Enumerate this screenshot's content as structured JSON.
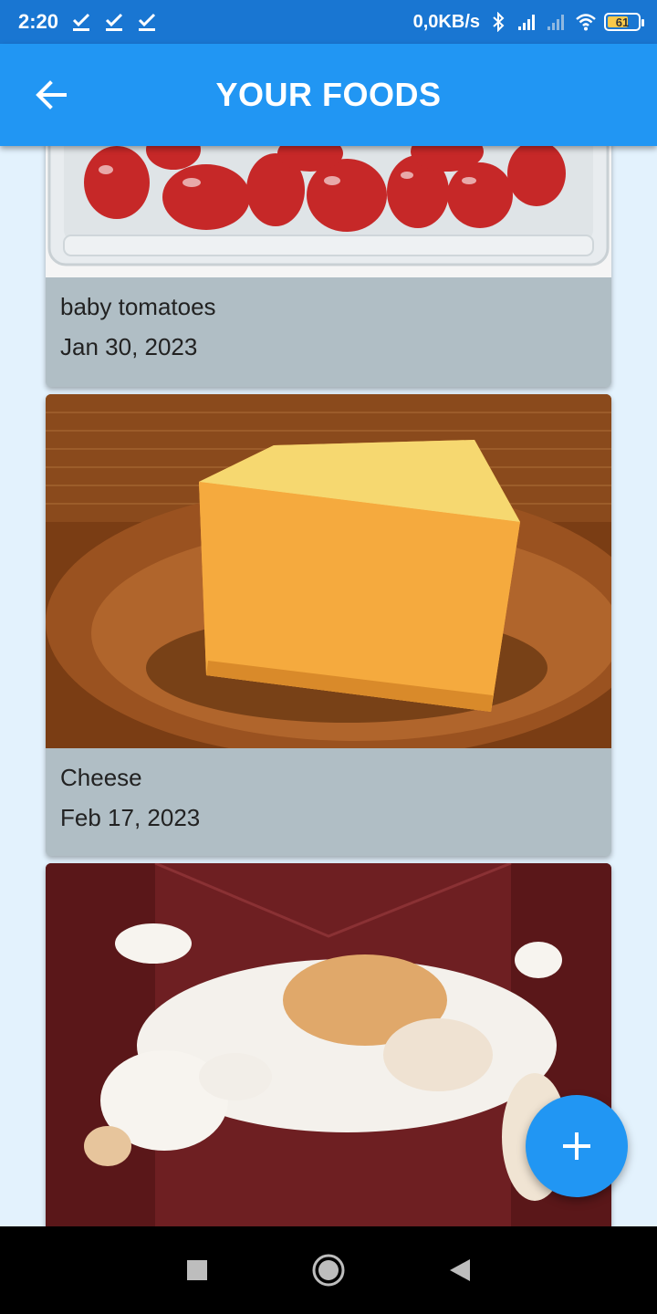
{
  "status_bar": {
    "time": "2:20",
    "net_speed": "0,0KB/s",
    "battery_level": "61",
    "icons": [
      "download-check-icon",
      "download-check-icon",
      "download-check-icon",
      "bluetooth-icon",
      "signal-icon",
      "signal-icon",
      "wifi-icon",
      "battery-icon"
    ]
  },
  "app_bar": {
    "title": "YOUR FOODS",
    "back_icon": "arrow-back-icon"
  },
  "foods": [
    {
      "name": "baby tomatoes",
      "date": "Jan 30, 2023",
      "image": "tomatoes-photo"
    },
    {
      "name": "Cheese",
      "date": "Feb 17, 2023",
      "image": "cheese-photo"
    },
    {
      "name": "",
      "date": "",
      "image": "cat-photo"
    }
  ],
  "fab": {
    "icon": "plus-icon"
  },
  "nav_bar": {
    "icons": [
      "recent-apps-icon",
      "home-icon",
      "back-icon"
    ]
  },
  "colors": {
    "primary": "#2196f3",
    "status_bar": "#1976d2",
    "background": "#e3f2fd",
    "card": "#b0bec5"
  }
}
